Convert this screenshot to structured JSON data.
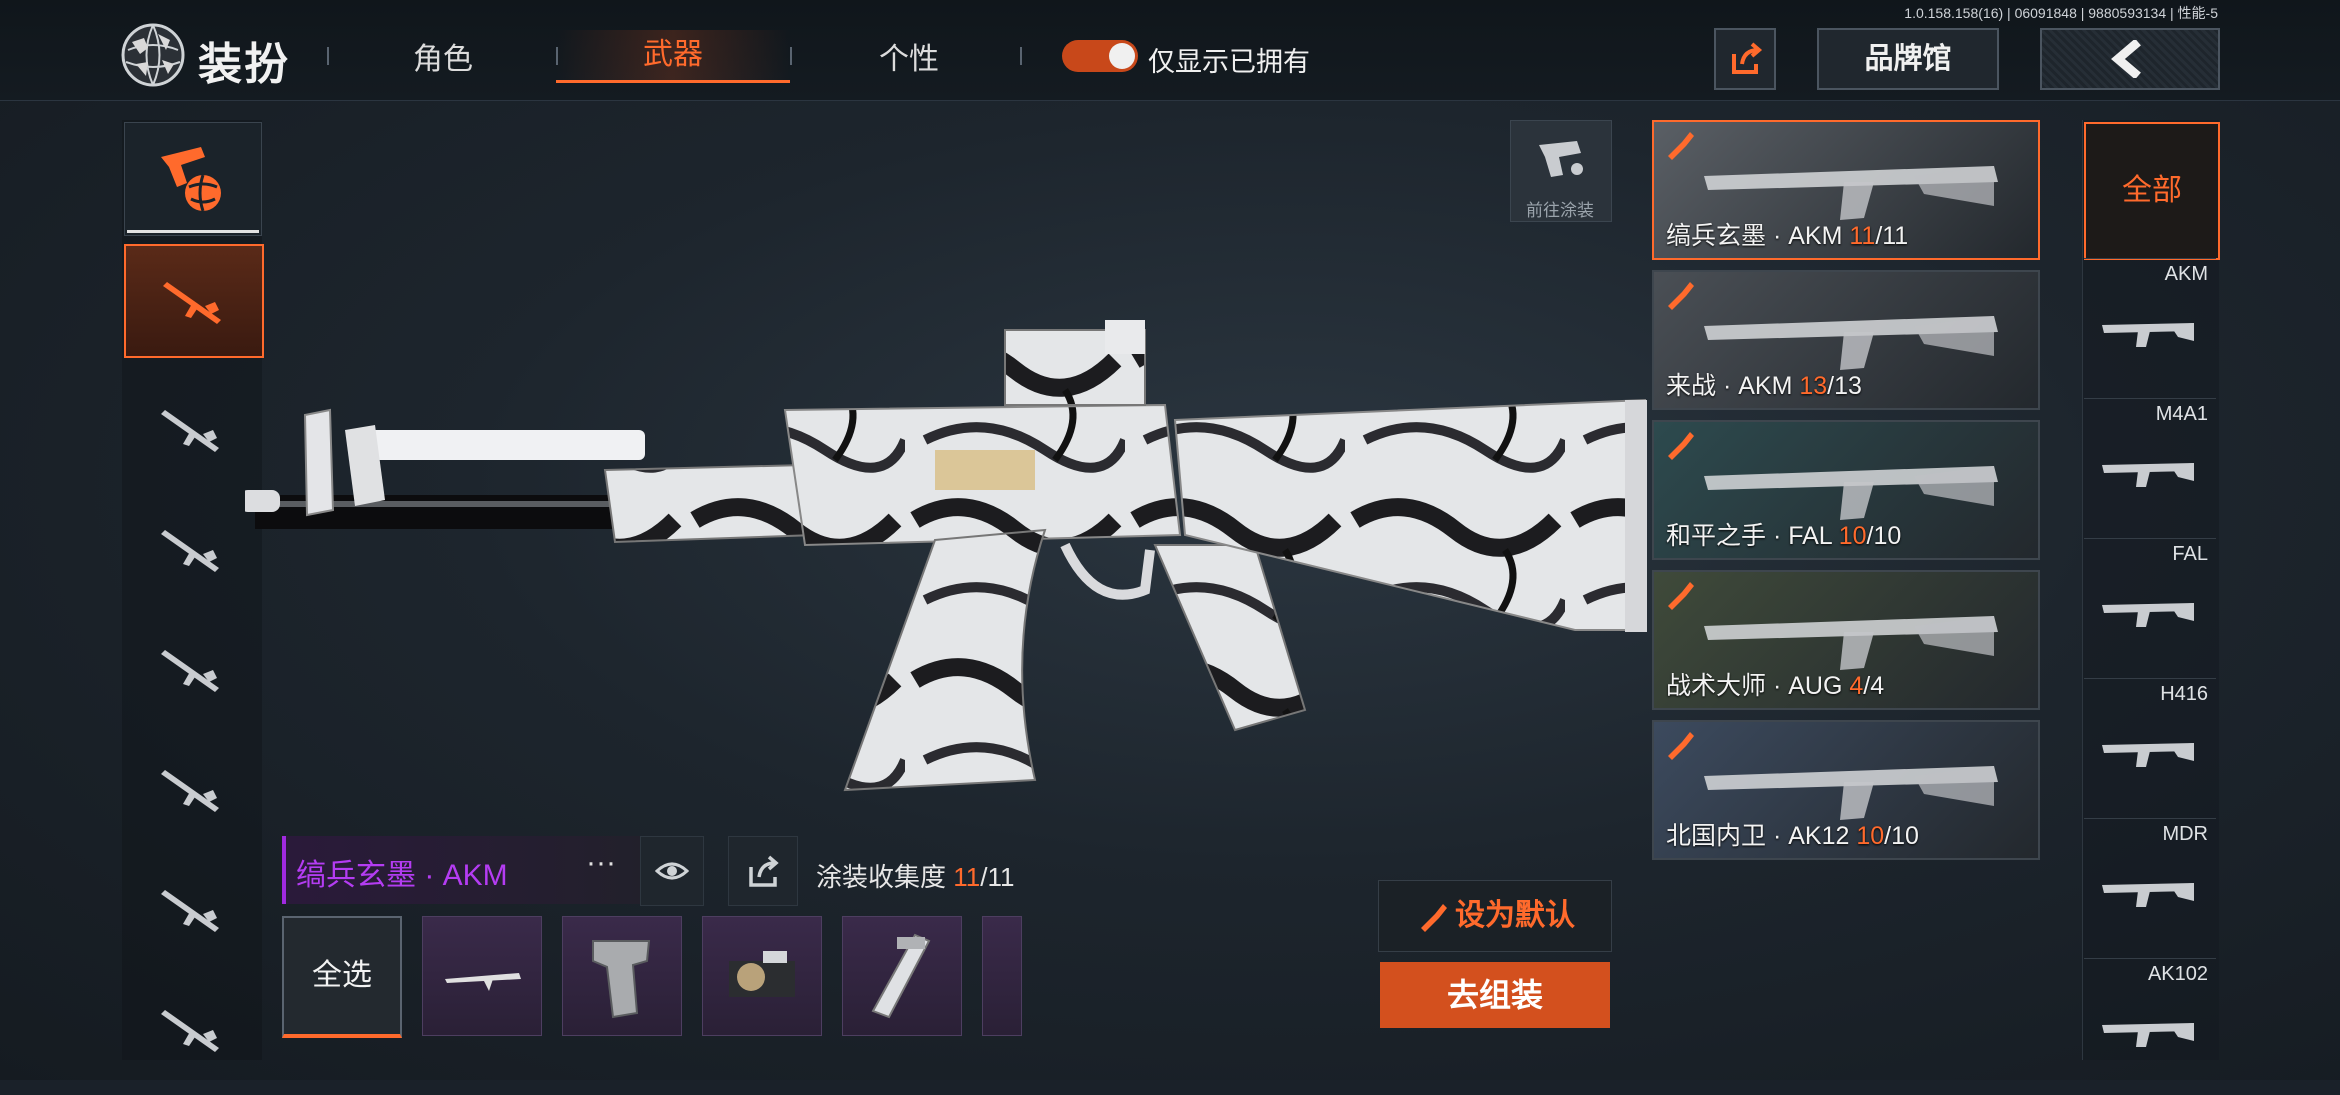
{
  "header": {
    "title": "装扮",
    "tabs": [
      "角色",
      "武器",
      "个性"
    ],
    "active_tab": "武器",
    "toggle_label": "仅显示已拥有",
    "toggle_on": true,
    "version": "1.0.158.158(16) | 06091848 | 9880593134 | 性能-5",
    "brand_label": "品牌馆"
  },
  "left_weapons": [
    "rifle-akm",
    "smg-p90",
    "sniper",
    "sniper-bolt",
    "rifle",
    "shotgun",
    "rifle-2"
  ],
  "paint_label": "前往涂装",
  "current": {
    "name": "缟兵玄墨 · AKM",
    "dots": "···",
    "collect_label": "涂装收集度",
    "collect_have": "11",
    "collect_total": "/11"
  },
  "select_all": "全选",
  "buttons": {
    "set_default": "设为默认",
    "assemble": "去组装"
  },
  "skins": [
    {
      "name": "缟兵玄墨 · AKM",
      "have": "11",
      "total": "/11",
      "active": true
    },
    {
      "name": "来战 · AKM",
      "have": "13",
      "total": "/13",
      "active": false
    },
    {
      "name": "和平之手 · FAL",
      "have": "10",
      "total": "/10",
      "active": false
    },
    {
      "name": "战术大师 · AUG",
      "have": "4",
      "total": "/4",
      "active": false
    },
    {
      "name": "北国内卫 · AK12",
      "have": "10",
      "total": "/10",
      "active": false
    }
  ],
  "filter": {
    "all": "全部",
    "items": [
      "AKM",
      "M4A1",
      "FAL",
      "H416",
      "MDR",
      "AK102"
    ]
  },
  "colors": {
    "accent": "#ff6a2c",
    "rare": "#b43cf2"
  }
}
